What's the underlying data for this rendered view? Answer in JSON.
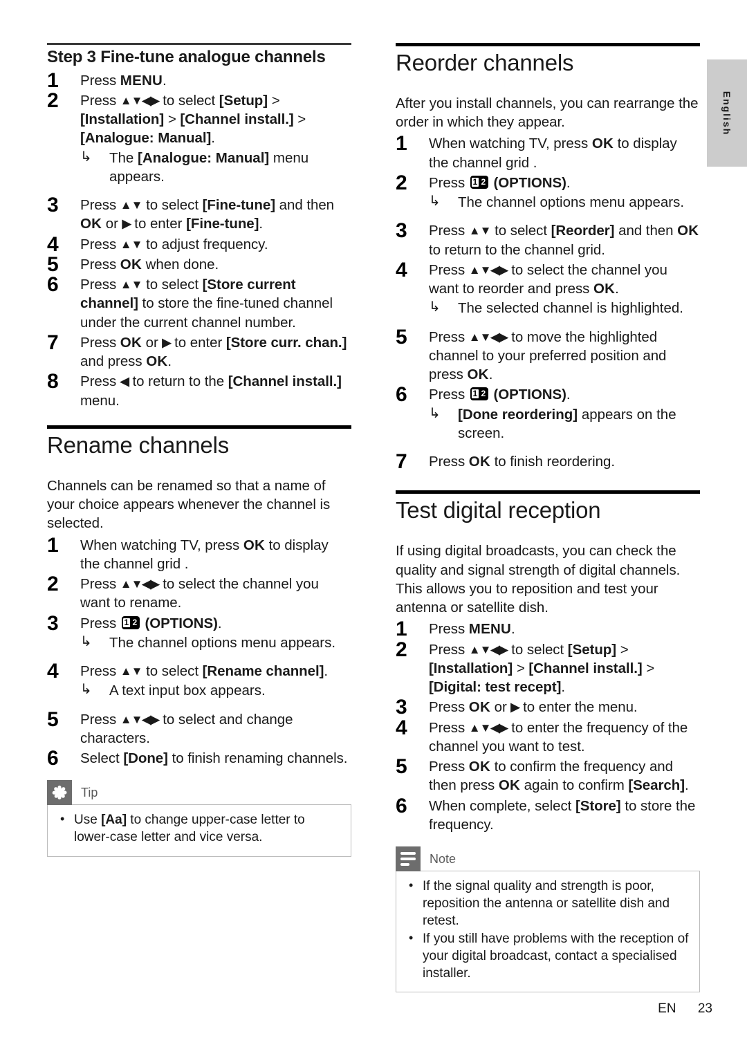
{
  "language_tab": {
    "label": "English"
  },
  "footer": {
    "lang_code": "EN",
    "page_number": "23"
  },
  "icons": {
    "options_one": "1",
    "options_two": "2"
  },
  "left_column": {
    "step3": {
      "title": "Step 3 Fine-tune analogue channels",
      "steps": [
        {
          "num": "1",
          "text_html": "Press <b class=\"key\">MENU</b>."
        },
        {
          "num": "2",
          "text_html": "Press <b class=\"nav\">▲▼◀▶</b> to select <b>[Setup]</b> &gt; <b>[Installation]</b> &gt; <b>[Channel install.]</b> &gt; <b>[Analogue: Manual]</b>.",
          "result_html": "The <b>[Analogue: Manual]</b> menu appears."
        },
        {
          "num": "3",
          "text_html": "Press <b class=\"nav\">▲▼</b> to select <b>[Fine-tune]</b> and then <b class=\"key\">OK</b> or <b class=\"nav\">▶</b> to enter <b>[Fine-tune]</b>."
        },
        {
          "num": "4",
          "text_html": "Press <b class=\"nav\">▲▼</b> to adjust frequency."
        },
        {
          "num": "5",
          "text_html": "Press <b class=\"key\">OK</b> when done."
        },
        {
          "num": "6",
          "text_html": "Press <b class=\"nav\">▲▼</b> to select <b>[Store current channel]</b> to store the fine-tuned channel under the current channel number."
        },
        {
          "num": "7",
          "text_html": "Press <b class=\"key\">OK</b> or <b class=\"nav\">▶</b> to enter <b>[Store curr. chan.]</b> and press <b class=\"key\">OK</b>."
        },
        {
          "num": "8",
          "text_html": "Press <b class=\"nav\">◀</b> to return to the <b>[Channel install.]</b> menu."
        }
      ]
    },
    "rename": {
      "title": "Rename channels",
      "intro": "Channels can be renamed so that a name of your choice appears whenever the channel is selected.",
      "steps": [
        {
          "num": "1",
          "text_html": "When watching TV, press <b class=\"key\">OK</b> to display the channel grid ."
        },
        {
          "num": "2",
          "text_html": "Press <b class=\"nav\">▲▼◀▶</b> to select the channel you want to rename."
        },
        {
          "num": "3",
          "text_html": "Press <span class=\"opt-icon\"><i class=\"one\">1</i><i class=\"two\">2</i></span> <b>(OPTIONS)</b>.",
          "result_html": "The channel options menu appears."
        },
        {
          "num": "4",
          "text_html": "Press <b class=\"nav\">▲▼</b> to select <b>[Rename channel]</b>.",
          "result_html": "A text input box appears."
        },
        {
          "num": "5",
          "text_html": "Press <b class=\"nav\">▲▼◀▶</b> to select and change characters."
        },
        {
          "num": "6",
          "text_html": "Select <b>[Done]</b> to finish renaming channels."
        }
      ],
      "tip": {
        "label": "Tip",
        "items_html": [
          "Use <b>[Aa]</b> to change upper-case letter to lower-case letter and vice versa."
        ]
      }
    }
  },
  "right_column": {
    "reorder": {
      "title": "Reorder channels",
      "intro": "After you install channels, you can rearrange the order in which they appear.",
      "steps": [
        {
          "num": "1",
          "text_html": "When watching TV, press <b class=\"key\">OK</b> to display the channel grid ."
        },
        {
          "num": "2",
          "text_html": "Press <span class=\"opt-icon\"><i class=\"one\">1</i><i class=\"two\">2</i></span> <b>(OPTIONS)</b>.",
          "result_html": "The channel options menu appears."
        },
        {
          "num": "3",
          "text_html": "Press <b class=\"nav\">▲▼</b> to select <b>[Reorder]</b> and then <b class=\"key\">OK</b> to return to the channel grid."
        },
        {
          "num": "4",
          "text_html": "Press <b class=\"nav\">▲▼◀▶</b> to select the channel you want to reorder and press <b class=\"key\">OK</b>.",
          "result_html": "The selected channel is highlighted."
        },
        {
          "num": "5",
          "text_html": "Press <b class=\"nav\">▲▼◀▶</b> to move the highlighted channel to your preferred position and press <b class=\"key\">OK</b>."
        },
        {
          "num": "6",
          "text_html": "Press <span class=\"opt-icon\"><i class=\"one\">1</i><i class=\"two\">2</i></span> <b>(OPTIONS)</b>.",
          "result_html": "<b>[Done reordering]</b> appears on the screen."
        },
        {
          "num": "7",
          "text_html": "Press <b class=\"key\">OK</b> to finish reordering."
        }
      ]
    },
    "test_digital": {
      "title": "Test digital reception",
      "intro": "If using digital broadcasts, you can check the quality and signal strength of digital channels. This allows you to reposition and test your antenna or satellite dish.",
      "steps": [
        {
          "num": "1",
          "text_html": "Press <b class=\"key\">MENU</b>."
        },
        {
          "num": "2",
          "text_html": "Press <b class=\"nav\">▲▼◀▶</b> to select <b>[Setup]</b> &gt; <b>[Installation]</b> &gt; <b>[Channel install.]</b> &gt; <b>[Digital: test recept]</b>."
        },
        {
          "num": "3",
          "text_html": "Press <b class=\"key\">OK</b> or <b class=\"nav\">▶</b> to enter the menu."
        },
        {
          "num": "4",
          "text_html": "Press <b class=\"nav\">▲▼◀▶</b> to enter the frequency of the channel you want to test."
        },
        {
          "num": "5",
          "text_html": "Press <b class=\"key\">OK</b> to confirm the frequency and then press <b class=\"key\">OK</b> again to confirm <b>[Search]</b>."
        },
        {
          "num": "6",
          "text_html": "When complete, select <b>[Store]</b> to store the frequency."
        }
      ],
      "note": {
        "label": "Note",
        "items_html": [
          "If the signal quality and strength is poor, reposition the antenna or satellite dish and retest.",
          "If you still have problems with the reception of your digital broadcast, contact a specialised installer."
        ]
      }
    }
  }
}
